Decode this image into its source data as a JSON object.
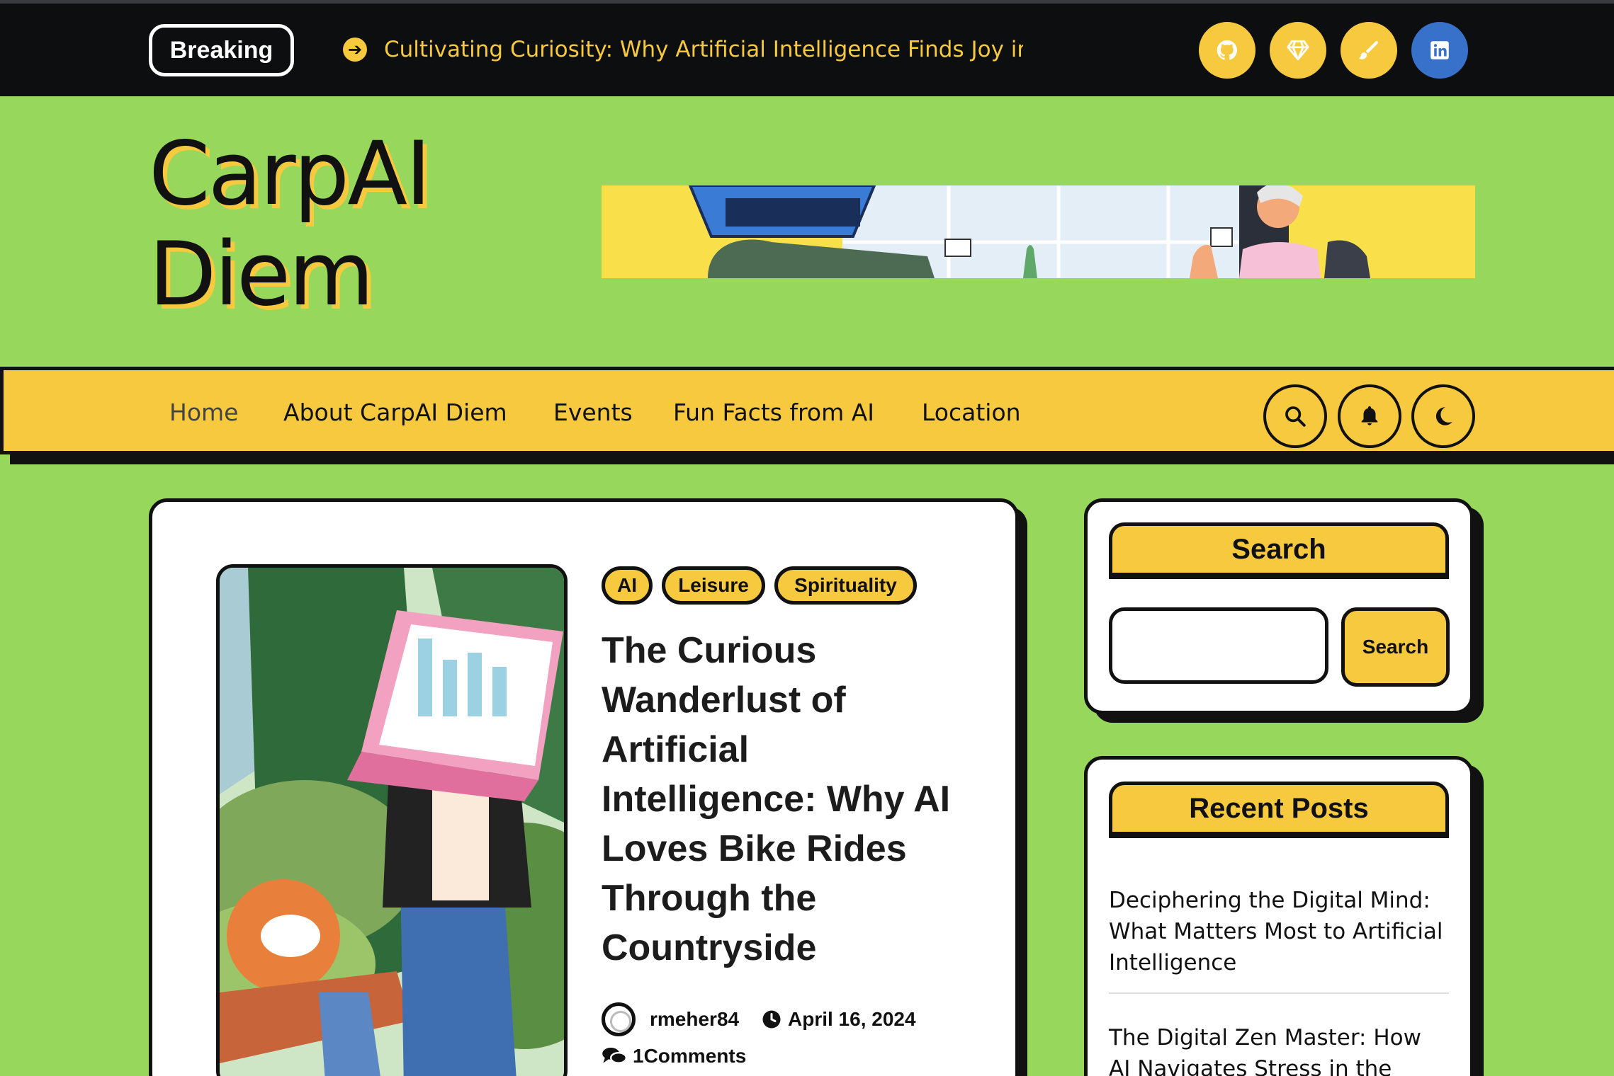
{
  "topbar": {
    "breaking_label": "Breaking",
    "ticker_text": "Cultivating Curiosity: Why Artificial Intelligence Finds Joy in G",
    "social_icons": [
      "github-icon",
      "gem-icon",
      "brush-icon",
      "linkedin-icon"
    ]
  },
  "header": {
    "site_title_line1": "CarpAI",
    "site_title_line2": "Diem"
  },
  "nav": {
    "items": [
      "Home",
      "About CarpAI Diem",
      "Events",
      "Fun Facts from AI",
      "Location"
    ],
    "buttons": [
      "search-icon",
      "bell-icon",
      "moon-icon"
    ]
  },
  "post": {
    "tags": [
      "AI",
      "Leisure",
      "Spirituality"
    ],
    "title": "The Curious Wanderlust of Artificial Intelligence: Why AI Loves Bike Rides Through the Countryside",
    "author": "rmeher84",
    "date": "April 16, 2024",
    "comments": "1Comments"
  },
  "sidebar": {
    "search_title": "Search",
    "search_input_value": "",
    "search_button": "Search",
    "recent_title": "Recent Posts",
    "recent_posts": [
      "Deciphering the Digital Mind: What Matters Most to Artificial Intelligence",
      "The Digital Zen Master: How AI Navigates Stress in the Virtual"
    ]
  },
  "colors": {
    "background_green": "#96d75c",
    "accent_yellow": "#f7c93e",
    "topbar_black": "#0d0e10",
    "linkedin_blue": "#3871c9"
  }
}
